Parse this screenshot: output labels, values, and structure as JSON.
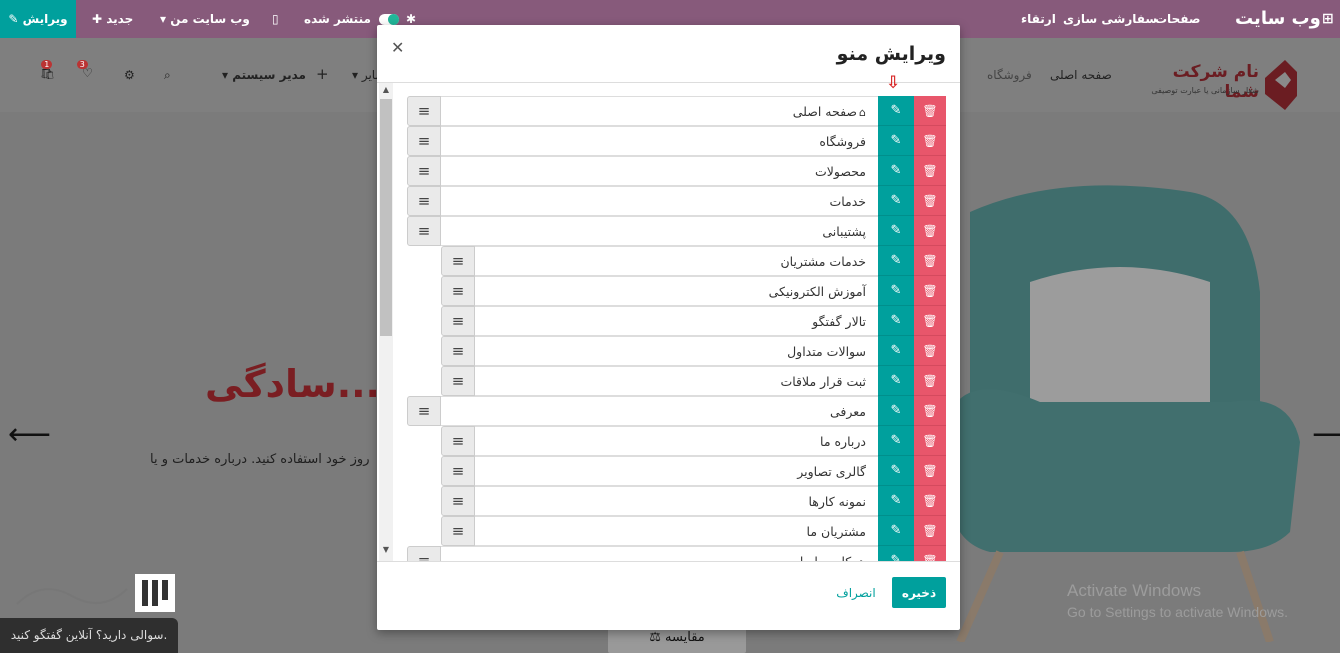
{
  "topbar": {
    "brand": "وب سایت",
    "pages": "صفحات",
    "customize": "سفارشی سازی",
    "upgrade": "ارتقاء",
    "published": "منتشر شده",
    "my_website": "وب سایت من",
    "new": "جدید",
    "edit": "ویرایش",
    "colors": {
      "bar": "#875a7b",
      "accent": "#00a09d"
    }
  },
  "site": {
    "logo_title": "نام شرکت شما",
    "logo_subtitle": "شعار سازمانی یا عبارت توصیفی",
    "nav_home": "صفحه اصلی",
    "nav_shop": "فروشگاه",
    "nav_other": "سایر",
    "nav_admin": "مدیر سیستم",
    "cart_badge": "1",
    "wishlist_badge": "3",
    "hero_title": "سادگی...",
    "hero_text": "روز خود استفاده کنید. درباره خدمات و یا",
    "compare": "مقایسه",
    "chat": "سوالی دارید؟ آنلاین گفتگو کنید.",
    "windows_line1": "Activate Windows",
    "windows_line2": "Go to Settings to activate Windows."
  },
  "modal": {
    "title": "ویرایش منو",
    "save": "ذخیره",
    "cancel": "انصراف",
    "items": [
      {
        "label": "صفحه اصلی",
        "level": 0,
        "home": true
      },
      {
        "label": "فروشگاه",
        "level": 0
      },
      {
        "label": "محصولات",
        "level": 0
      },
      {
        "label": "خدمات",
        "level": 0
      },
      {
        "label": "پشتیبانی",
        "level": 0
      },
      {
        "label": "خدمات مشتریان",
        "level": 1
      },
      {
        "label": "آموزش الکترونیکی",
        "level": 1
      },
      {
        "label": "تالار گفتگو",
        "level": 1
      },
      {
        "label": "سوالات متداول",
        "level": 1
      },
      {
        "label": "ثبت قرار ملاقات",
        "level": 1
      },
      {
        "label": "معرفی",
        "level": 0
      },
      {
        "label": "درباره ما",
        "level": 1
      },
      {
        "label": "گالری تصاویر",
        "level": 1
      },
      {
        "label": "نمونه کارها",
        "level": 1
      },
      {
        "label": "مشتریان ما",
        "level": 1
      },
      {
        "label": "همکاری با ما",
        "level": 0
      }
    ]
  }
}
